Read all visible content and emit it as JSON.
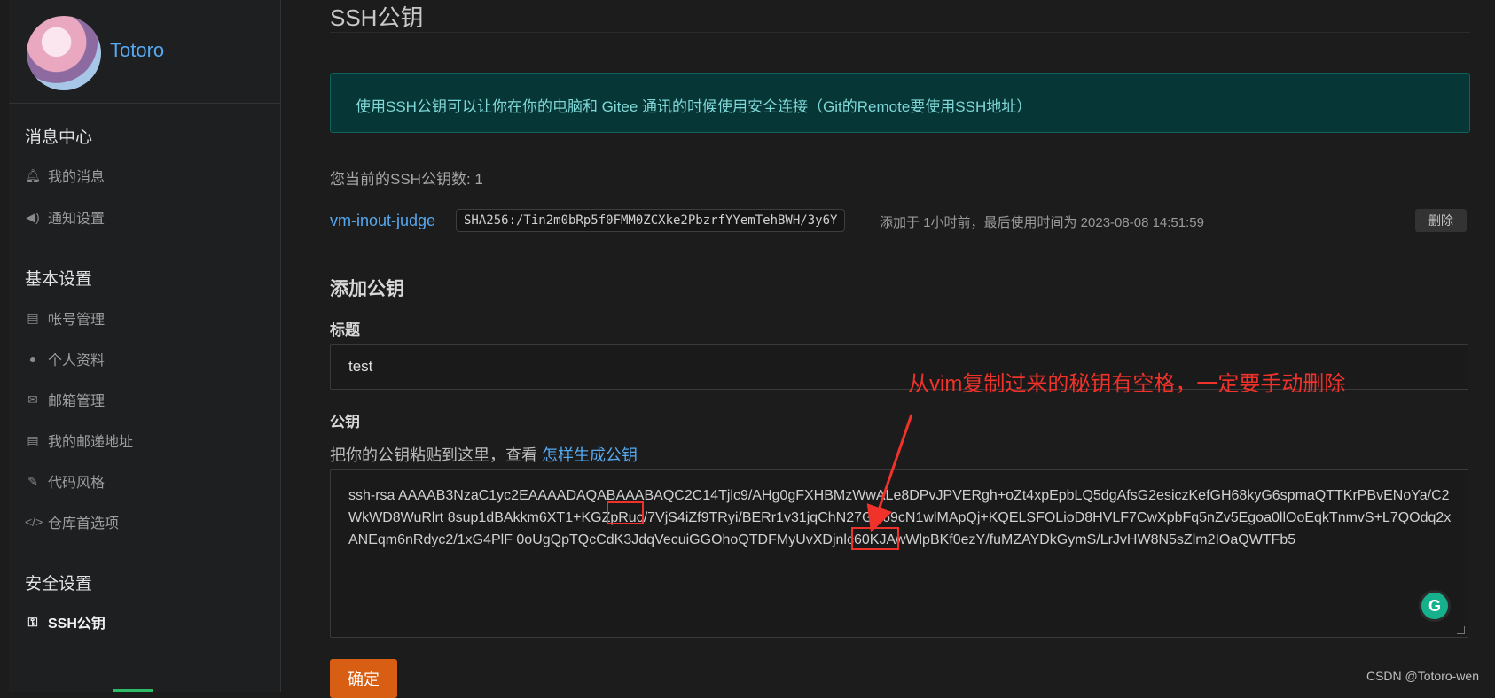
{
  "sidebar": {
    "profile": {
      "name": "Totoro"
    },
    "groups": [
      {
        "title": "消息中心",
        "items": [
          {
            "label": "我的消息",
            "icon": "bell-icon",
            "active": true
          },
          {
            "label": "通知设置",
            "icon": "speaker-icon"
          }
        ]
      },
      {
        "title": "基本设置",
        "items": [
          {
            "label": "帐号管理",
            "icon": "id-card-icon"
          },
          {
            "label": "个人资料",
            "icon": "user-icon"
          },
          {
            "label": "邮箱管理",
            "icon": "envelope-icon"
          },
          {
            "label": "我的邮递地址",
            "icon": "address-card-icon"
          },
          {
            "label": "代码风格",
            "icon": "brush-icon"
          },
          {
            "label": "仓库首选项",
            "icon": "code-icon"
          }
        ]
      },
      {
        "title": "安全设置",
        "items": [
          {
            "label": "SSH公钥",
            "icon": "key-icon",
            "active": true
          }
        ]
      }
    ]
  },
  "main": {
    "page_title": "SSH公钥",
    "info": "使用SSH公钥可以让你在你的电脑和 Gitee 通讯的时候使用安全连接（Git的Remote要使用SSH地址）",
    "key_count": "您当前的SSH公钥数: 1",
    "keys": [
      {
        "name": "vm-inout-judge",
        "fingerprint": "SHA256:/Tin2m0bRp5f0FMM0ZCXke2PbzrfYYemTehBWH/3y6Y",
        "meta": "添加于 1小时前，最后使用时间为 2023-08-08 14:51:59",
        "delete_label": "删除"
      }
    ],
    "add_section": {
      "title": "添加公钥",
      "title_label": "标题",
      "title_value": "test",
      "key_label": "公钥",
      "hint_text": "把你的公钥粘贴到这里，查看 ",
      "hint_link": "怎样生成公钥",
      "key_value": "ssh-rsa AAAAB3NzaC1yc2EAAAADAQABAAABAQC2C14Tjlc9/AHg0gFXHBMzWwALe8DPvJPVERgh+oZt4xpEpbLQ5dgAfsG2esiczKefGH68kyG6spmaQTTKrPBvENoYa/C2WkWD8WuRlrt    8sup1dBAkkm6XT1+KGZpRuc/7VjS4iZf9TRyi/BERr1v31jqChN27GX69cN1wlMApQj+KQELSFOLioD8HVLF7CwXpbFq5nZv5Egoa0llOoEqkTnmvS+L7QOdq2xANEqm6nRdyc2/1xG4PlF    0oUgQpTQcCdK3JdqVecuiGGOhoQTDFMyUvXDjnlc60KJAwWlpBKf0ezY/fuMZAYDkGymS/LrJvHW8N5sZlm2IOaQWTFb5",
      "submit_label": "确定",
      "grammar_badge": "G"
    }
  },
  "annotation": {
    "text": "从vim复制过来的秘钥有空格，一定要手动删除",
    "color": "#f0322b"
  },
  "watermark": "CSDN @Totoro-wen"
}
